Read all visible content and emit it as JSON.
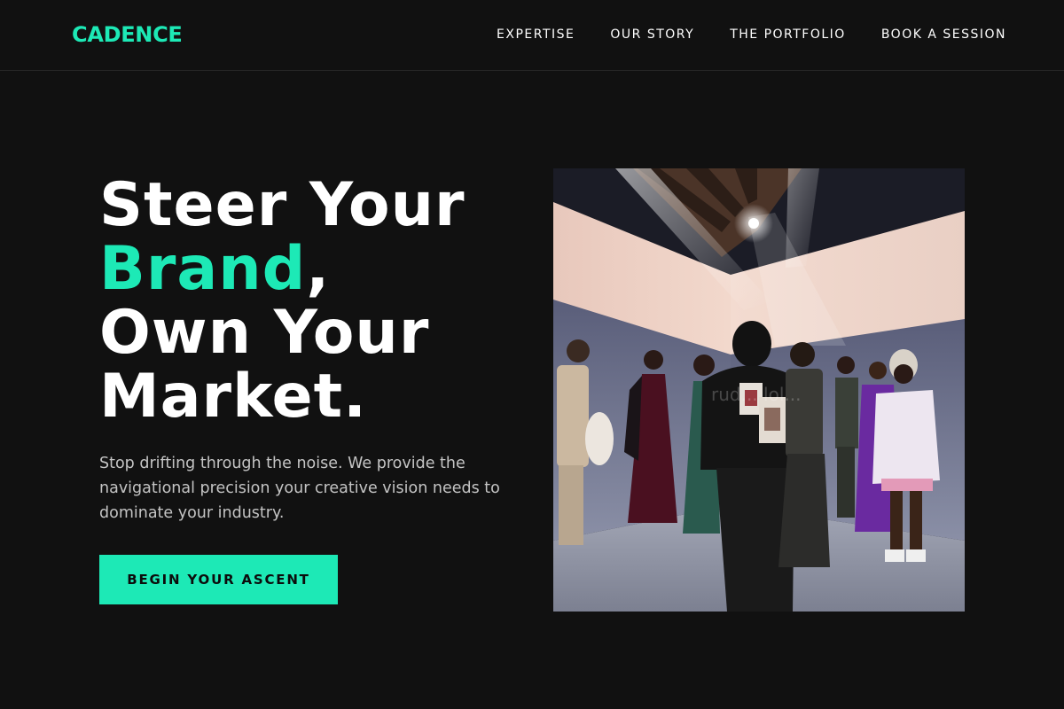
{
  "header": {
    "logo": "CADENCE",
    "nav": [
      {
        "label": "EXPERTISE"
      },
      {
        "label": "OUR STORY"
      },
      {
        "label": "THE PORTFOLIO"
      },
      {
        "label": "BOOK A SESSION"
      }
    ]
  },
  "hero": {
    "headline": {
      "line1": "Steer Your",
      "accent_word": "Brand",
      "comma": ",",
      "line3": "Own Your",
      "line4": "Market."
    },
    "subtext": "Stop drifting through the noise. We provide the navigational precision your creative vision needs to dominate your industry.",
    "cta_label": "BEGIN YOUR ASCENT",
    "image": {
      "watermark": "rud... lol..."
    }
  },
  "colors": {
    "background": "#111111",
    "accent": "#1de9b6",
    "text": "#ffffff",
    "muted_text": "#c4c4c4"
  }
}
